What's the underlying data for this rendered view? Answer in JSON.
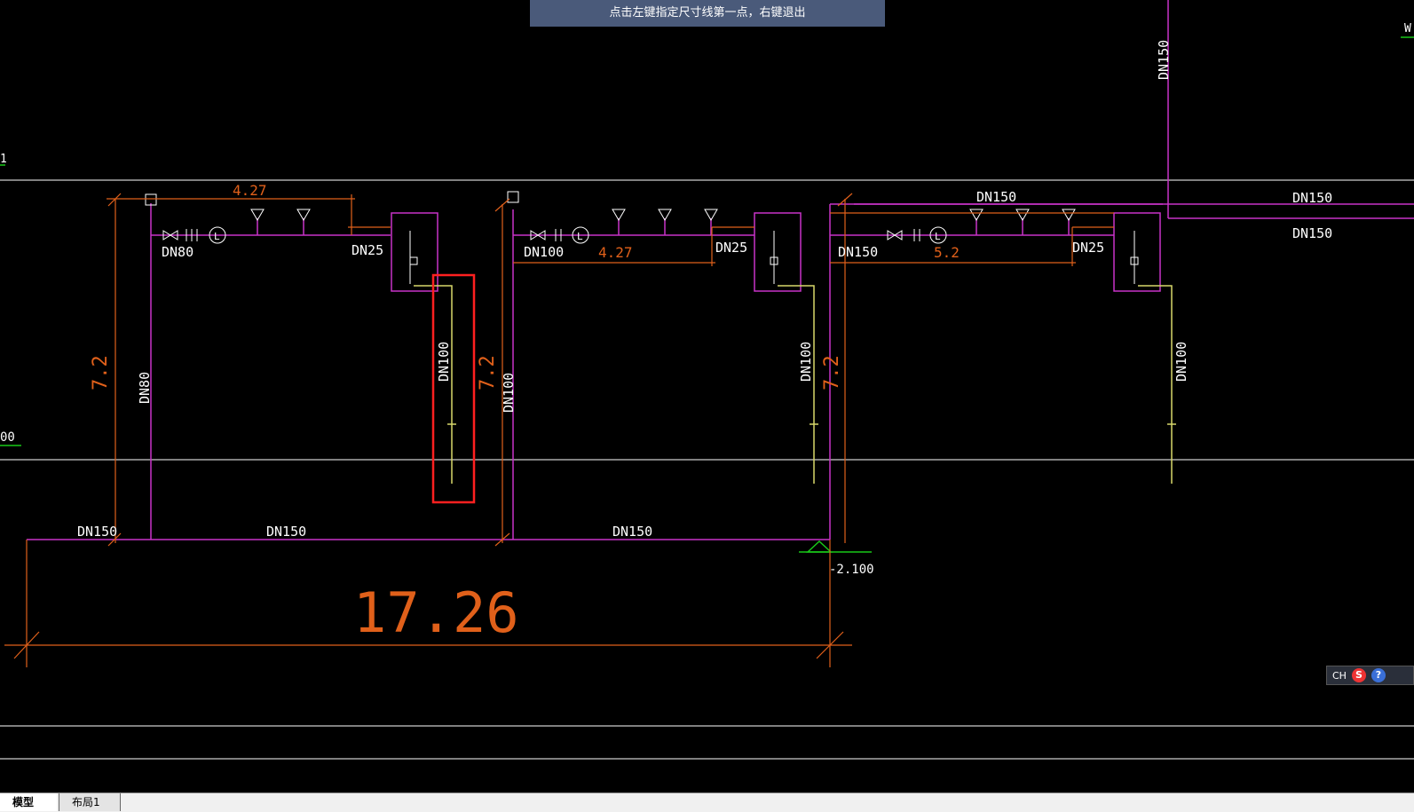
{
  "prompt": {
    "text": "点击左键指定尺寸线第一点，右键退出"
  },
  "tabs": {
    "model": "模型",
    "layout1": "布局1"
  },
  "ime": {
    "lang": "CH",
    "logo": "S",
    "help": "?"
  },
  "labels": {
    "dn150": "DN150",
    "dn100": "DN100",
    "dn80": "DN80",
    "dn25": "DN25",
    "dim_427": "4.27",
    "dim_52": "5.2",
    "dim_72": "7.2",
    "dim_1726": "17.26",
    "elev": "-2.100",
    "edge_w": "W",
    "edge_00": "00",
    "edge_1": "1",
    "l_mark": "L"
  },
  "colors": {
    "magenta": "#c832c8",
    "orange": "#e0601a",
    "white": "#ffffff",
    "yellow": "#d8d86a",
    "green": "#19c819",
    "red": "#ff2020"
  }
}
